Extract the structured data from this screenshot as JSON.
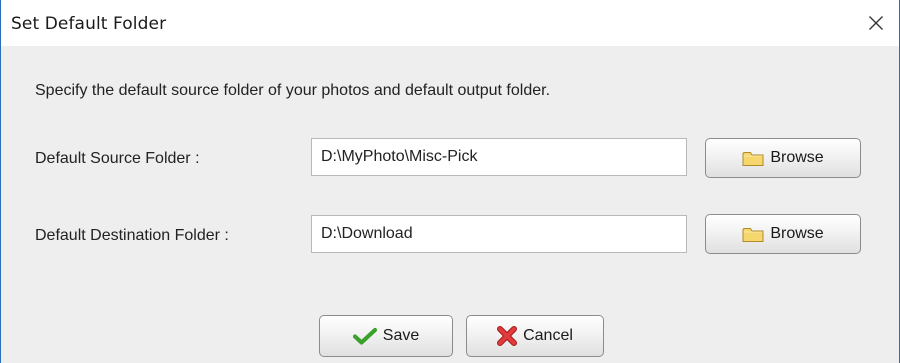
{
  "window": {
    "title": "Set Default Folder"
  },
  "dialog": {
    "description": "Specify the default source folder of your photos and default output folder.",
    "source": {
      "label": "Default Source Folder :",
      "value": "D:\\MyPhoto\\Misc-Pick",
      "browse_label": "Browse"
    },
    "destination": {
      "label": "Default Destination Folder :",
      "value": "D:\\Download",
      "browse_label": "Browse"
    },
    "save_label": "Save",
    "cancel_label": "Cancel"
  },
  "icons": {
    "close": "close-icon",
    "folder": "folder-icon",
    "save": "checkmark-icon",
    "cancel": "x-icon"
  },
  "colors": {
    "window_border": "#2b6fb8",
    "client_background": "#eeeeee",
    "folder_icon": "#f5d76e",
    "save_check": "#3aa12c",
    "cancel_x": "#d93030"
  }
}
